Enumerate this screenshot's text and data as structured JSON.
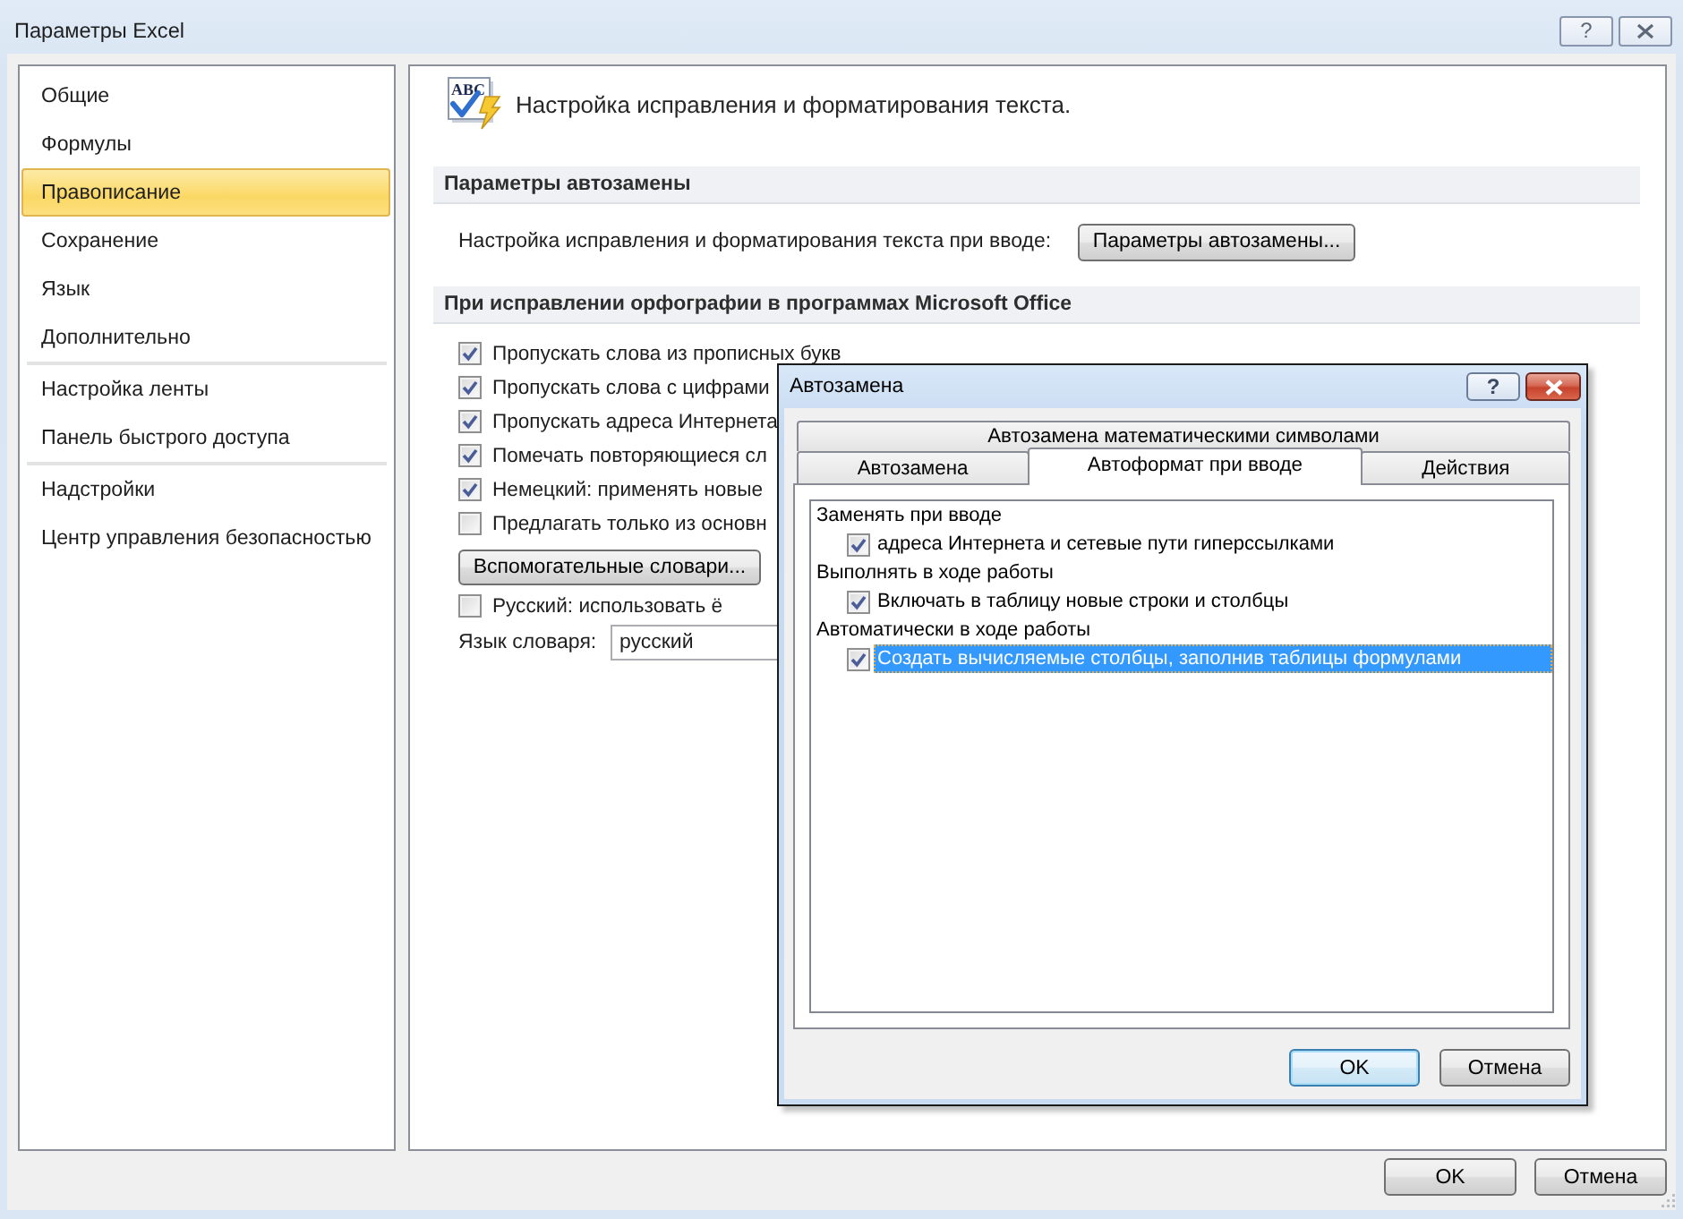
{
  "window": {
    "title": "Параметры Excel",
    "help_button": "?"
  },
  "sidebar": {
    "groups": [
      {
        "items": [
          {
            "label": "Общие",
            "selected": false
          },
          {
            "label": "Формулы",
            "selected": false
          },
          {
            "label": "Правописание",
            "selected": true
          },
          {
            "label": "Сохранение",
            "selected": false
          },
          {
            "label": "Язык",
            "selected": false
          },
          {
            "label": "Дополнительно",
            "selected": false
          }
        ]
      },
      {
        "items": [
          {
            "label": "Настройка ленты",
            "selected": false
          },
          {
            "label": "Панель быстрого доступа",
            "selected": false
          }
        ]
      },
      {
        "items": [
          {
            "label": "Надстройки",
            "selected": false
          },
          {
            "label": "Центр управления безопасностью",
            "selected": false
          }
        ]
      }
    ]
  },
  "header": {
    "icon_text": "ABC",
    "title": "Настройка исправления и форматирования текста."
  },
  "sections": [
    {
      "title": "Параметры автозамены",
      "rows": [
        {
          "kind": "button_row",
          "label": "Настройка исправления и форматирования текста при вводе:",
          "button": "Параметры автозамены..."
        }
      ]
    },
    {
      "title": "При исправлении орфографии в программах Microsoft Office",
      "rows": [
        {
          "kind": "checkbox",
          "label": "Пропускать слова из прописных букв",
          "checked": true
        },
        {
          "kind": "checkbox",
          "label": "Пропускать слова с цифрами",
          "checked": true
        },
        {
          "kind": "checkbox",
          "label": "Пропускать адреса Интернета",
          "checked": true
        },
        {
          "kind": "checkbox",
          "label": "Помечать повторяющиеся сл",
          "checked": true
        },
        {
          "kind": "checkbox",
          "label": "Немецкий: применять новые",
          "checked": true
        },
        {
          "kind": "checkbox",
          "label": "Предлагать только из основн",
          "checked": false
        },
        {
          "kind": "button",
          "label": "Вспомогательные словари..."
        },
        {
          "kind": "checkbox",
          "label": "Русский: использовать ё",
          "checked": false
        },
        {
          "kind": "select",
          "label": "Язык словаря:",
          "value": "русский"
        }
      ]
    }
  ],
  "buttons": [
    {
      "label": "OK"
    },
    {
      "label": "Отмена"
    }
  ],
  "dialog": {
    "title": "Автозамена",
    "help_button": "?",
    "tab_rows": [
      {
        "tabs": [
          {
            "label": "Автозамена математическими символами",
            "selected": false
          }
        ]
      },
      {
        "tabs": [
          {
            "label": "Автозамена",
            "selected": false
          },
          {
            "label": "Автоформат при вводе",
            "selected": true
          },
          {
            "label": "Действия",
            "selected": false
          }
        ]
      }
    ],
    "groups": [
      {
        "heading": "Заменять при вводе",
        "options": [
          {
            "label": "адреса Интернета и сетевые пути гиперссылками",
            "checked": true,
            "selected": false
          }
        ]
      },
      {
        "heading": "Выполнять в ходе работы",
        "options": [
          {
            "label": "Включать в таблицу новые строки и столбцы",
            "checked": true,
            "selected": false
          }
        ]
      },
      {
        "heading": "Автоматически в ходе работы",
        "options": [
          {
            "label": "Создать вычисляемые столбцы, заполнив таблицы формулами",
            "checked": true,
            "selected": true
          }
        ]
      }
    ],
    "buttons": [
      {
        "label": "OK",
        "focused": true
      },
      {
        "label": "Отмена",
        "focused": false
      }
    ]
  }
}
